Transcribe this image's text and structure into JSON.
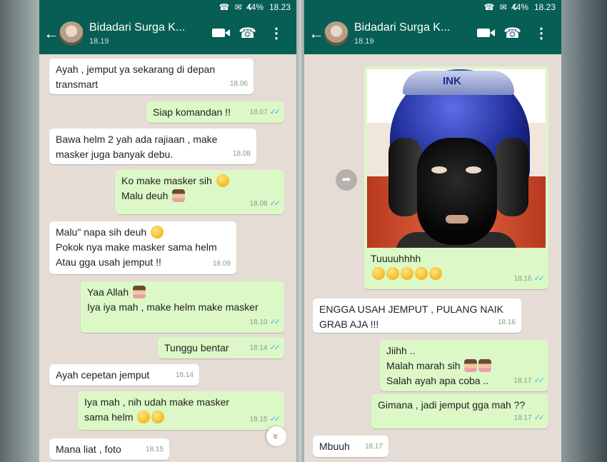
{
  "status": {
    "signal": "☎ ✉ ☇",
    "battery": "44%",
    "time": "18.23"
  },
  "chat": {
    "contact_name": "Bidadari Surga K...",
    "subtitle": "18.19"
  },
  "left_messages": [
    {
      "dir": "in",
      "text": "Ayah , jemput ya sekarang di depan\ntransmart",
      "time": "18.06"
    },
    {
      "dir": "out",
      "text": "Siap komandan !!",
      "time": "18.07"
    },
    {
      "dir": "in",
      "text": "Bawa helm 2 yah ada rajiaan , make\nmasker juga banyak debu.",
      "time": "18.08"
    },
    {
      "dir": "out",
      "text": "Ko make masker sih",
      "text2": "Malu deuh",
      "time": "18.08"
    },
    {
      "dir": "in",
      "text": "Malu\" napa sih deuh",
      "text2": "Pokok nya make masker sama helm\nAtau gga usah jemput !!",
      "time": "18.09"
    },
    {
      "dir": "out",
      "text": "Yaa Allah",
      "text2": "Iya iya mah , make helm make masker",
      "time": "18.10"
    },
    {
      "dir": "out",
      "text": "Tunggu bentar",
      "time": "18.14"
    },
    {
      "dir": "in",
      "text": "Ayah cepetan jemput",
      "time": "18.14"
    },
    {
      "dir": "out",
      "text": "Iya mah , nih udah make masker\nsama helm",
      "time": "18.15"
    },
    {
      "dir": "in",
      "text": "Mana liat , foto",
      "time": "18.15"
    }
  ],
  "right_messages": [
    {
      "dir": "out",
      "text": "Tuuuuhhhh",
      "time": "18.16"
    },
    {
      "dir": "in",
      "text": "ENGGA USAH JEMPUT , PULANG NAIK\nGRAB AJA !!!",
      "time": "18.16"
    },
    {
      "dir": "out",
      "text": "Jiihh ..\nMalah marah sih",
      "text2": "Salah ayah apa coba ..",
      "time": "18.17"
    },
    {
      "dir": "out",
      "text": "Gimana , jadi jemput gga mah ??",
      "time": "18.17"
    },
    {
      "dir": "in",
      "text": "Mbuuh",
      "time": "18.17"
    }
  ],
  "icons": {
    "back": "←",
    "call": "☎",
    "more": "⋮",
    "share": "➦",
    "scroll_down": "»"
  }
}
